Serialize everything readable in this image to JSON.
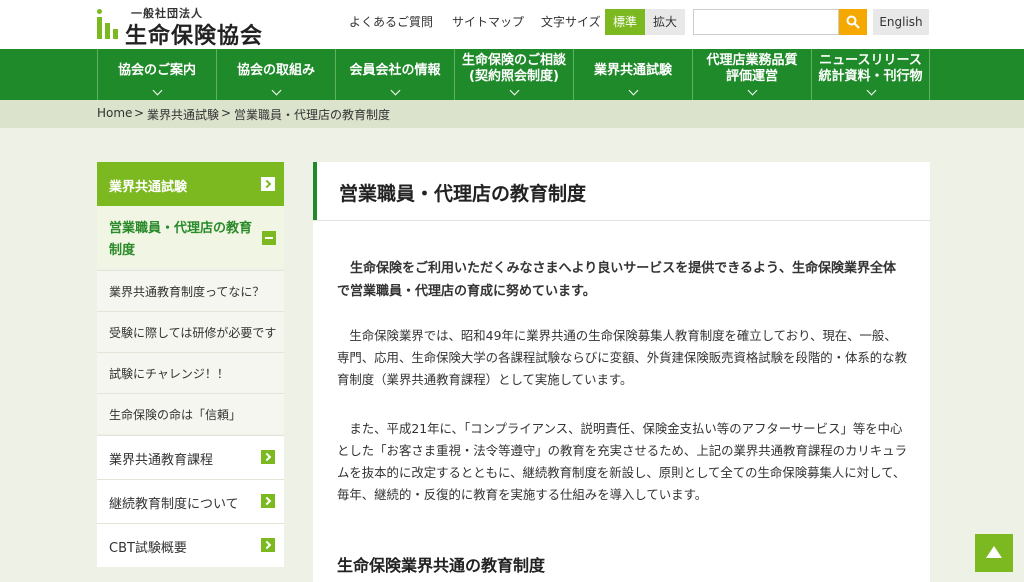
{
  "header": {
    "logo_small": "一般社団法人",
    "logo_main": "生命保険協会",
    "faq": "よくあるご質問",
    "sitemap": "サイトマップ",
    "font_size_label": "文字サイズ",
    "font_standard": "標準",
    "font_large": "拡大",
    "search_placeholder": "",
    "search_icon": "search-icon",
    "english": "English"
  },
  "nav": {
    "items": [
      {
        "label": "協会のご案内"
      },
      {
        "label": "協会の取組み"
      },
      {
        "label": "会員会社の情報"
      },
      {
        "label": "生命保険のご相談\n(契約照会制度)"
      },
      {
        "label": "業界共通試験"
      },
      {
        "label": "代理店業務品質\n評価運営"
      },
      {
        "label": "ニュースリリース\n統計資料・刊行物"
      }
    ]
  },
  "breadcrumb": {
    "home": "Home",
    "sep": ">",
    "level1": "業界共通試験",
    "current": "営業職員・代理店の教育制度"
  },
  "sidebar": {
    "header": "業界共通試験",
    "current": "営業職員・代理店の教育制度",
    "subitems": [
      {
        "label": "業界共通教育制度ってなに？"
      },
      {
        "label": "受験に際しては研修が必要です"
      },
      {
        "label": "試験にチャレンジ！！"
      },
      {
        "label": "生命保険の命は「信頼」"
      }
    ],
    "items": [
      {
        "label": "業界共通教育課程"
      },
      {
        "label": "継続教育制度について"
      },
      {
        "label": "CBT試験概要"
      }
    ]
  },
  "main": {
    "title": "営業職員・代理店の教育制度",
    "lead": "　生命保険をご利用いただくみなさまへより良いサービスを提供できるよう、生命保険業界全体で営業職員・代理店の育成に努めています。",
    "para1": "　生命保険業界では、昭和49年に業界共通の生命保険募集人教育制度を確立しており、現在、一般、専門、応用、生命保険大学の各課程試験ならびに変額、外貨建保険販売資格試験を段階的・体系的な教育制度（業界共通教育課程）として実施しています。",
    "para2": "　また、平成21年に、「コンプライアンス、説明責任、保険金支払い等のアフターサービス」等を中心とした「お客さま重視・法令等遵守」の教育を充実させるため、上記の業界共通教育課程のカリキュラムを抜本的に改定するとともに、継続教育制度を新設し、原則として全ての生命保険募集人に対して、毎年、継続的・反復的に教育を実施する仕組みを導入しています。",
    "section_title": "生命保険業界共通の教育制度"
  },
  "colors": {
    "nav_green": "#1f8a2a",
    "accent_green": "#7cb81f",
    "search_orange": "#f5a800"
  }
}
